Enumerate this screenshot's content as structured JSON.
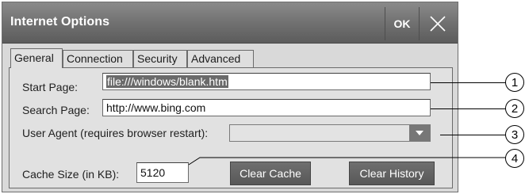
{
  "window": {
    "title": "Internet Options",
    "ok_label": "OK",
    "close_icon": "close-icon"
  },
  "tabs": [
    {
      "label": "General",
      "active": true
    },
    {
      "label": "Connection",
      "active": false
    },
    {
      "label": "Security",
      "active": false
    },
    {
      "label": "Advanced",
      "active": false
    }
  ],
  "general": {
    "start_page_label": "Start Page:",
    "start_page_value": "file:///windows/blank.htm",
    "search_page_label": "Search Page:",
    "search_page_value": "http://www.bing.com",
    "user_agent_label": "User Agent (requires browser restart):",
    "user_agent_value": "",
    "cache_size_label": "Cache Size (in KB):",
    "cache_size_value": "5120",
    "clear_cache_label": "Clear Cache",
    "clear_history_label": "Clear History"
  },
  "callouts": [
    "1",
    "2",
    "3",
    "4"
  ],
  "colors": {
    "titlebar": "#6f6f6f",
    "panel": "#e1e1e1",
    "button": "#606060"
  }
}
